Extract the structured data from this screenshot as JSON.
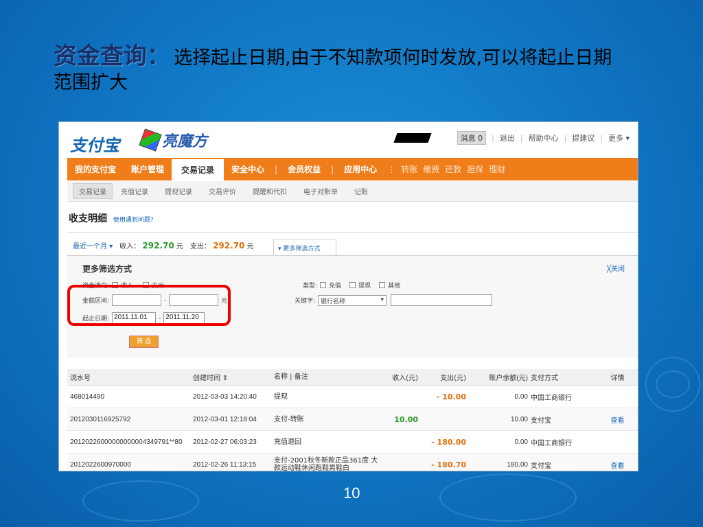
{
  "slide": {
    "title_key": "资金查询：",
    "title_text": "选择起止日期,由于不知款项何时发放,可以将起止日期",
    "title_line2": "范围扩大",
    "page_number": "10"
  },
  "header": {
    "logo": "支付宝",
    "partner_logo": "亮魔方",
    "links": [
      "消息 0",
      "退出",
      "帮助中心",
      "提建议",
      "更多"
    ]
  },
  "nav": {
    "tabs": [
      "我的支付宝",
      "账户管理",
      "交易记录",
      "安全中心",
      "会员权益",
      "应用中心"
    ],
    "active": "交易记录",
    "quick": [
      "转账",
      "缴费",
      "还款",
      "担保",
      "理财"
    ]
  },
  "subnav": {
    "items": [
      "交易记录",
      "充值记录",
      "提现记录",
      "交易评价",
      "提醒和代扣",
      "电子对账单",
      "记账"
    ]
  },
  "page": {
    "title": "收支明细",
    "help": "使用遇到问题?"
  },
  "summary": {
    "range": "最近一个月",
    "income_label": "收入：",
    "income_value": "292.70",
    "unit": "元",
    "expense_label": "支出：",
    "expense_value": "292.70",
    "more_filters": "更多筛选方式"
  },
  "filter": {
    "title": "更多筛选方式",
    "close": "关闭",
    "flow_label": "资金流向:",
    "flow_in": "收入",
    "flow_out": "支出",
    "amount_label": "金额区间:",
    "amount_unit": "元",
    "date_label": "起止日期:",
    "date_start": "2011.11.01",
    "date_end": "2011.11.20",
    "type_label": "类型:",
    "type_recharge": "充值",
    "type_withdraw": "提现",
    "type_other": "其他",
    "keyword_label": "关键字:",
    "keyword_select": "银行名称",
    "button": "筛 选"
  },
  "table": {
    "headers": [
      "流水号",
      "创建时间 ⇕",
      "名称 | 备注",
      "收入(元)",
      "支出(元)",
      "账户余额(元)",
      "支付方式",
      "详情"
    ],
    "rows": [
      {
        "id": "468014490",
        "time": "2012-03-03 14:20:40",
        "name": "提现",
        "income": "",
        "expense": "- 10.00",
        "balance": "0.00",
        "method": "中国工商银行",
        "detail": ""
      },
      {
        "id": "2012030116925792",
        "time": "2012-03-01 12:18:04",
        "name": "支付-转账",
        "income": "10.00",
        "expense": "",
        "balance": "10.00",
        "method": "支付宝",
        "detail": "查看"
      },
      {
        "id": "20120226000000000004349791**80",
        "time": "2012-02-27 06:03:23",
        "name": "充值退回",
        "income": "",
        "expense": "- 180.00",
        "balance": "0.00",
        "method": "中国工商银行",
        "detail": ""
      },
      {
        "id": "2012022600970000",
        "time": "2012-02-26 11:13:15",
        "name": "支付-2001秋冬新款正品361度 大款运动鞋休闲跑鞋男鞋白",
        "income": "",
        "expense": "- 180.70",
        "balance": "180.00",
        "method": "支付宝",
        "detail": "查看"
      }
    ]
  }
}
